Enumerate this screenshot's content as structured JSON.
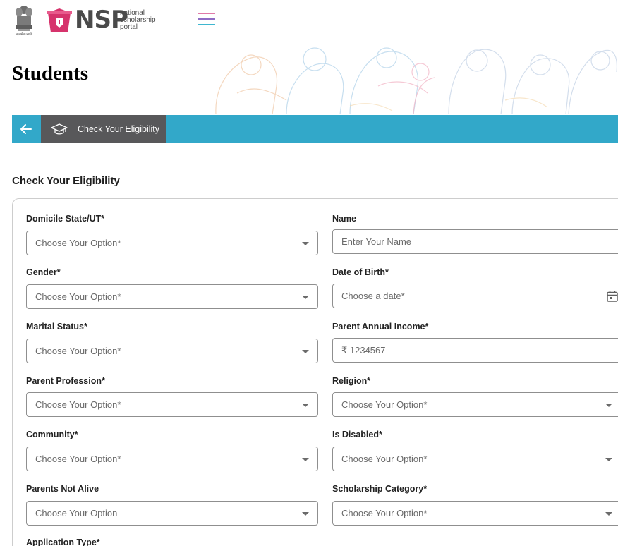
{
  "header": {
    "logo_brand": "NSP",
    "logo_subtitle": [
      "national",
      "scholarship",
      "portal"
    ],
    "emblem_caption": "सत्यमेव जयते",
    "menu_icon": "hamburger-icon"
  },
  "page": {
    "title": "Students"
  },
  "breadcrumb": {
    "back_icon": "arrow-left-icon",
    "item_icon": "graduation-cap-icon",
    "item_label": "Check Your Eligibility"
  },
  "form": {
    "title": "Check Your Eligibility",
    "fields": {
      "domicile": {
        "label": "Domicile State/UT*",
        "value": "Choose Your Option*"
      },
      "name": {
        "label": "Name",
        "placeholder": "Enter Your Name"
      },
      "gender": {
        "label": "Gender*",
        "value": "Choose Your Option*"
      },
      "dob": {
        "label": "Date of Birth*",
        "placeholder": "Choose a date*"
      },
      "marital": {
        "label": "Marital Status*",
        "value": "Choose Your Option*"
      },
      "income": {
        "label": "Parent Annual Income*",
        "value": "₹ 1234567"
      },
      "profession": {
        "label": "Parent Profession*",
        "value": "Choose Your Option*"
      },
      "religion": {
        "label": "Religion*",
        "value": "Choose Your Option*"
      },
      "community": {
        "label": "Community*",
        "value": "Choose Your Option*"
      },
      "disabled": {
        "label": "Is Disabled*",
        "value": "Choose Your Option*"
      },
      "parents_not_alive": {
        "label": "Parents Not Alive",
        "value": "Choose Your Option"
      },
      "scholarship_category": {
        "label": "Scholarship Category*",
        "value": "Choose Your Option*"
      },
      "application_type": {
        "label": "Application Type*"
      }
    }
  },
  "colors": {
    "bar_blue": "#32a8c9",
    "crumb_gray": "#58585a",
    "brand_pink": "#d6336c",
    "menu_lines": [
      "#e07aa7",
      "#8f6cc4",
      "#3fb7d0"
    ]
  }
}
